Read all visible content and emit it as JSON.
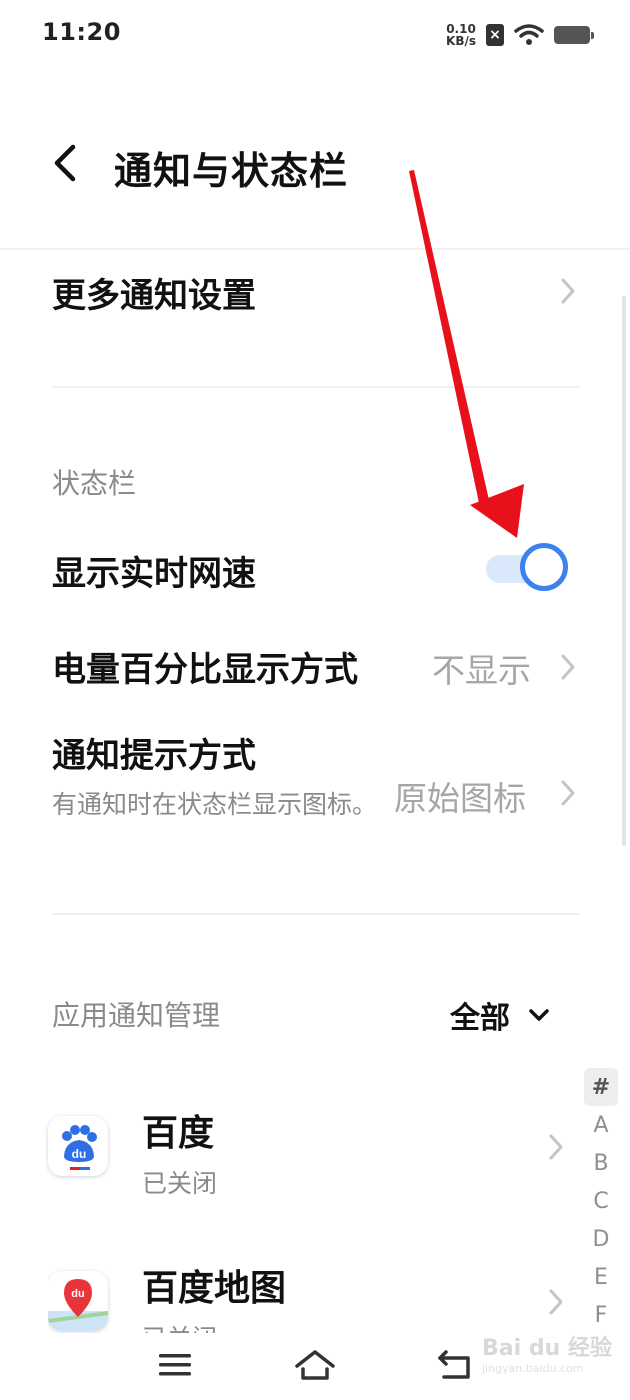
{
  "status_bar": {
    "time": "11:20",
    "net_speed_value": "0.10",
    "net_speed_unit": "KB/s",
    "icons": [
      "sim-disabled-icon",
      "wifi-icon",
      "battery-icon"
    ]
  },
  "header": {
    "title": "通知与状态栏",
    "back_icon": "back-chevron-icon"
  },
  "settings": {
    "more_notifications": "更多通知设置",
    "status_bar_section": "状态栏",
    "show_net_speed": {
      "label": "显示实时网速",
      "enabled": true
    },
    "battery_percent": {
      "label": "电量百分比显示方式",
      "value": "不显示"
    },
    "notification_style": {
      "label": "通知提示方式",
      "description": "有通知时在状态栏显示图标。",
      "value": "原始图标"
    }
  },
  "app_notifications": {
    "section_title": "应用通知管理",
    "filter_label": "全部",
    "apps": [
      {
        "name": "百度",
        "status": "已关闭",
        "icon": "baidu-app-icon"
      },
      {
        "name": "百度地图",
        "status": "已关闭",
        "icon": "baidu-map-app-icon"
      }
    ]
  },
  "index_bar": [
    "#",
    "A",
    "B",
    "C",
    "D",
    "E",
    "F"
  ],
  "nav_bar": {
    "icons": [
      "menu-icon",
      "home-icon",
      "return-icon"
    ]
  },
  "watermark": {
    "main": "Bai du 经验",
    "sub": "jingyan.baidu.com"
  },
  "colors": {
    "accent": "#3b82ee",
    "annotation_arrow": "#e8101a",
    "secondary_text": "#8a8a8a"
  }
}
